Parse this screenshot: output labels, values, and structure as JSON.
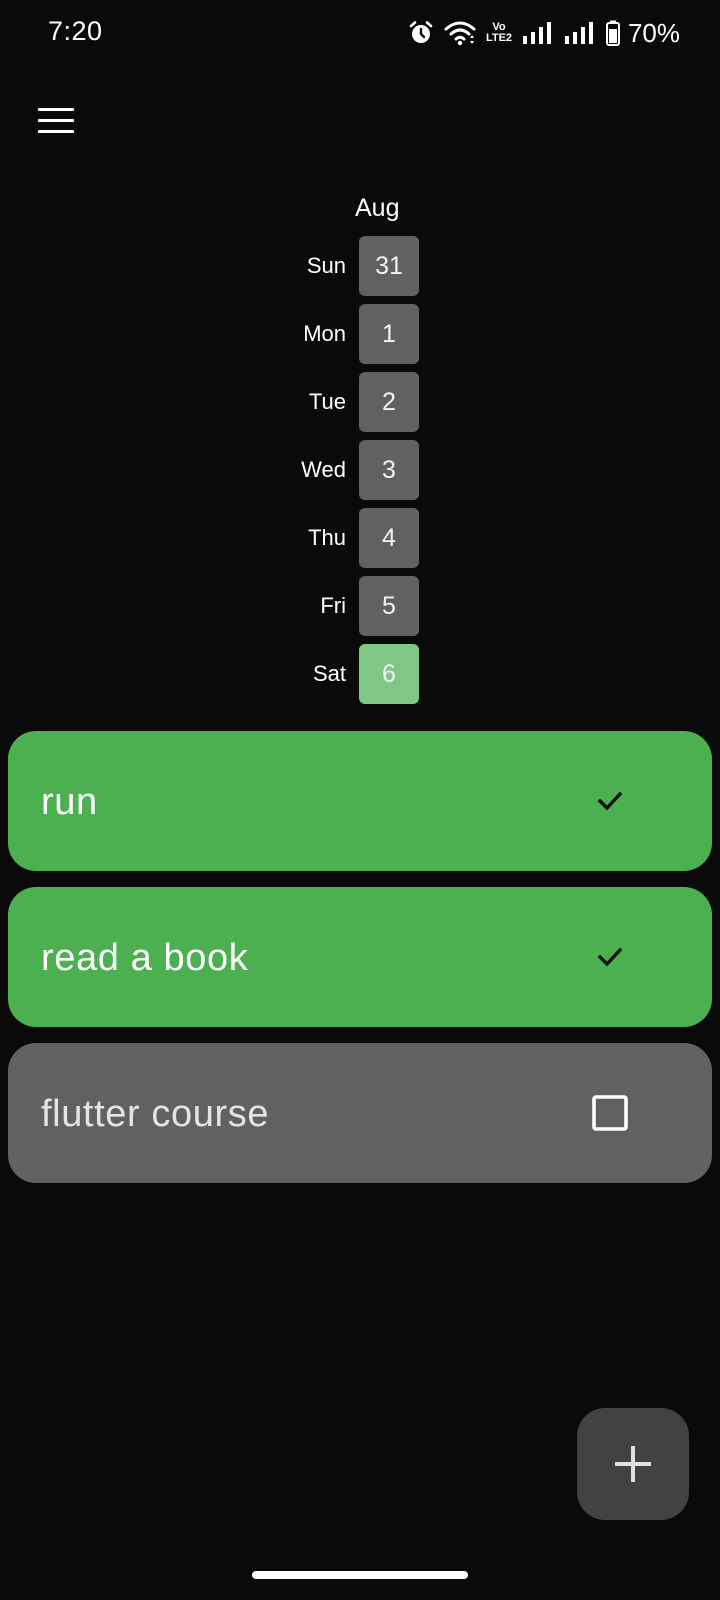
{
  "status_bar": {
    "time": "7:20",
    "volte_top": "Vo",
    "volte_bottom": "LTE2",
    "battery_percent": "70%",
    "icons": [
      "alarm-icon",
      "wifi-icon",
      "volte-icon",
      "signal-icon",
      "signal-icon",
      "battery-icon"
    ]
  },
  "app": {
    "menu_icon": "hamburger-menu-icon"
  },
  "calendar": {
    "month": "Aug",
    "days": [
      {
        "name": "Sun",
        "date": "31",
        "selected": false
      },
      {
        "name": "Mon",
        "date": "1",
        "selected": false
      },
      {
        "name": "Tue",
        "date": "2",
        "selected": false
      },
      {
        "name": "Wed",
        "date": "3",
        "selected": false
      },
      {
        "name": "Thu",
        "date": "4",
        "selected": false
      },
      {
        "name": "Fri",
        "date": "5",
        "selected": false
      },
      {
        "name": "Sat",
        "date": "6",
        "selected": true
      }
    ]
  },
  "habits": [
    {
      "name": "run",
      "completed": true
    },
    {
      "name": "read a book",
      "completed": true
    },
    {
      "name": "flutter course",
      "completed": false
    }
  ],
  "fab": {
    "icon": "plus-icon"
  },
  "colors": {
    "background": "#0a0a0a",
    "completed": "#4caf50",
    "pending": "#616161",
    "today": "#81c784",
    "fab": "#424242"
  }
}
